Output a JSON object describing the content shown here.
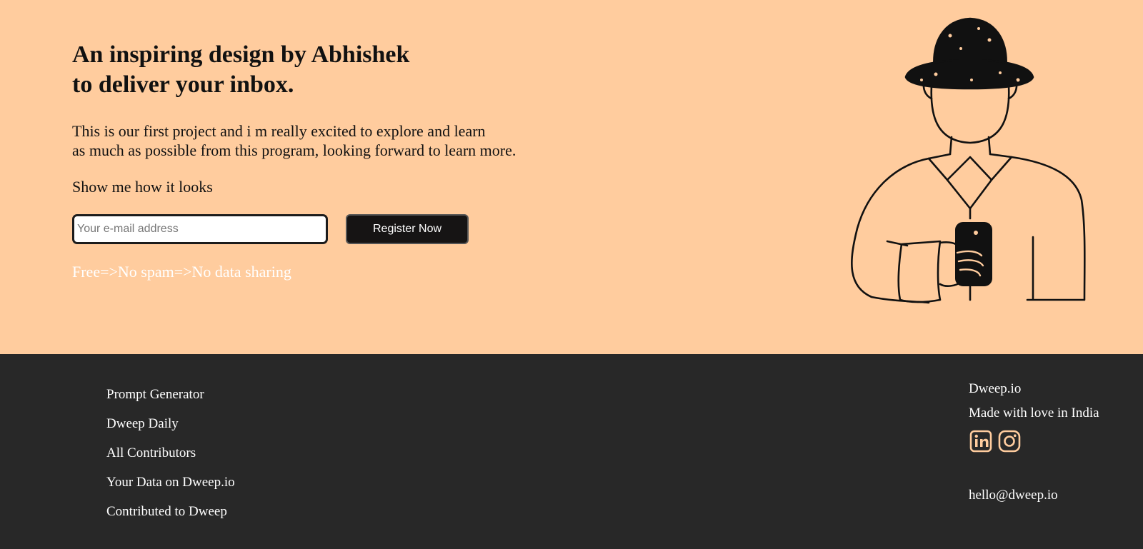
{
  "hero": {
    "headline_line1": "An inspiring design by Abhishek",
    "headline_line2": "to deliver your inbox.",
    "description_line1": "This is our first project and i m really excited to explore and learn",
    "description_line2": "as much as possible from this program, looking forward to learn more.",
    "show_text": "Show me how it looks",
    "email_placeholder": "Your e-mail address",
    "email_value": "",
    "register_label": "Register Now",
    "tagline": "Free=>No spam=>No data sharing",
    "illustration_icon": "person-with-hat-holding-phone-illustration"
  },
  "footer": {
    "links": [
      "Prompt Generator",
      "Dweep Daily",
      "All Contributors",
      "Your Data on Dweep.io",
      "Contributed to Dweep"
    ],
    "brand": "Dweep.io",
    "made_with": "Made with love in India",
    "social": [
      {
        "icon": "linkedin-icon"
      },
      {
        "icon": "instagram-icon"
      }
    ],
    "email": "hello@dweep.io"
  },
  "colors": {
    "hero_bg": "#ffcc9e",
    "footer_bg": "#282828",
    "button_bg": "#161414",
    "icon_accent": "#ffcc9e",
    "text_dark": "#111111",
    "text_light": "#ffffff"
  }
}
